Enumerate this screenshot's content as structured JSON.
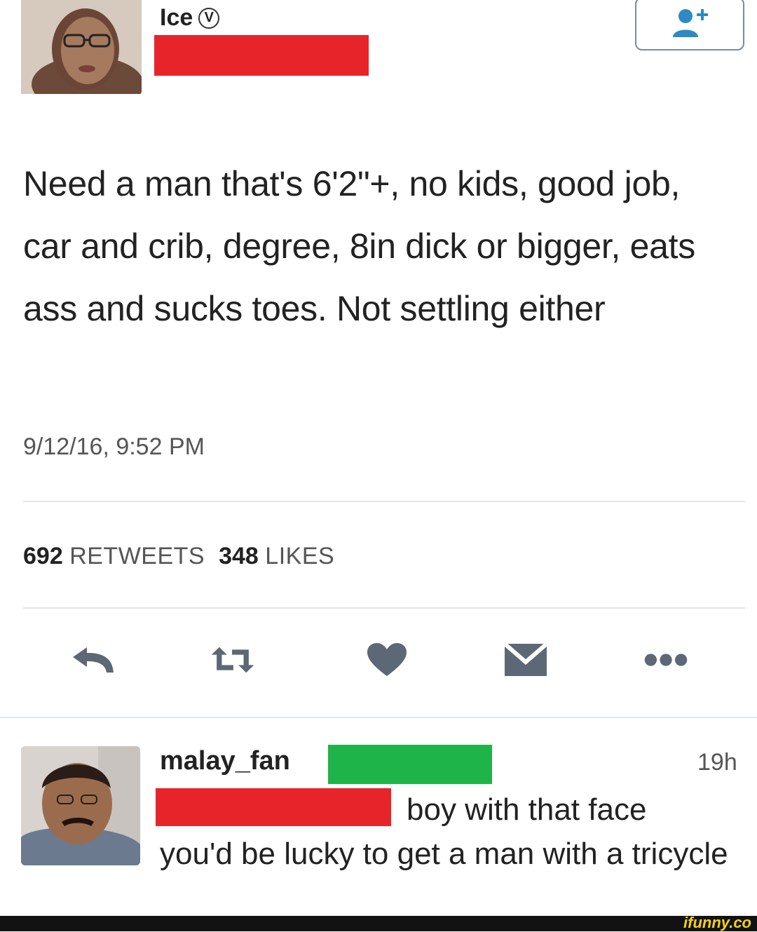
{
  "header": {
    "display_name": "Ice",
    "verified_symbol": "V",
    "redaction_color": "#e8242b",
    "follow_icon": "add-user-icon"
  },
  "tweet": {
    "text": "Need a man that's 6'2\"+, no kids, good job, car and crib, degree, 8in dick or bigger, eats ass and sucks toes. Not settling either",
    "timestamp": "9/12/16, 9:52 PM",
    "retweets_count": "692",
    "retweets_label": "RETWEETS",
    "likes_count": "348",
    "likes_label": "LIKES"
  },
  "actions": [
    {
      "icon": "reply-icon"
    },
    {
      "icon": "retweet-icon"
    },
    {
      "icon": "heart-icon"
    },
    {
      "icon": "message-icon"
    },
    {
      "icon": "more-icon"
    }
  ],
  "reply": {
    "username": "malay_fan",
    "time": "19h",
    "text_line1": "boy with that face",
    "text_rest": "you'd be lucky to get a man with a tricycle",
    "redaction_colors": [
      "#1fb44a",
      "#e8242b"
    ]
  },
  "footer": {
    "watermark": "ifunny.co",
    "bar_color": "#121212",
    "logo_color": "#f7d117"
  },
  "colors": {
    "icon_gray": "#5c6876",
    "text": "#222222",
    "muted": "#555555"
  }
}
